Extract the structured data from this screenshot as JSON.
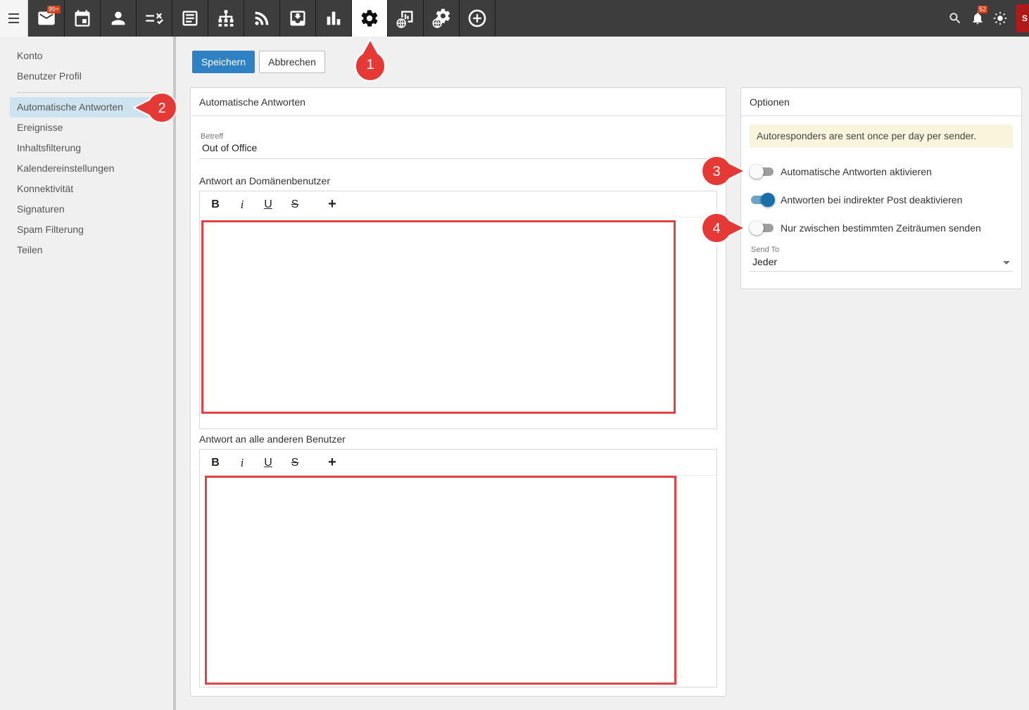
{
  "topbar": {
    "menu_icon": "hamburger-icon",
    "tabs": [
      {
        "icon": "mail-icon",
        "badge": "99+"
      },
      {
        "icon": "calendar-icon"
      },
      {
        "icon": "contacts-icon"
      },
      {
        "icon": "tasks-icon"
      },
      {
        "icon": "notes-icon"
      },
      {
        "icon": "sitemap-icon"
      },
      {
        "icon": "rss-icon"
      },
      {
        "icon": "inbox-download-icon"
      },
      {
        "icon": "bar-chart-icon"
      },
      {
        "icon": "gear-icon",
        "active": true
      },
      {
        "icon": "domain-report-icon"
      },
      {
        "icon": "domain-settings-icon"
      },
      {
        "icon": "add-circle-icon"
      }
    ],
    "notifications_badge": "52",
    "avatar_letter": "S"
  },
  "sidebar": {
    "items": [
      {
        "label": "Konto"
      },
      {
        "label": "Benutzer Profil"
      },
      {
        "label": "Automatische Antworten",
        "selected": true
      },
      {
        "label": "Ereignisse"
      },
      {
        "label": "Inhaltsfilterung"
      },
      {
        "label": "Kalendereinstellungen"
      },
      {
        "label": "Konnektivität"
      },
      {
        "label": "Signaturen"
      },
      {
        "label": "Spam Filterung"
      },
      {
        "label": "Teilen"
      }
    ]
  },
  "actions": {
    "save_label": "Speichern",
    "cancel_label": "Abbrechen"
  },
  "autoreply": {
    "panel_title": "Automatische Antworten",
    "subject_label": "Betreff",
    "subject_value": "Out of Office",
    "domain_users_label": "Antwort an Domänenbenutzer",
    "other_users_label": "Antwort an alle anderen Benutzer",
    "toolbar": {
      "bold": "B",
      "italic": "i",
      "underline": "U",
      "strike": "S",
      "more": "+"
    }
  },
  "options": {
    "panel_title": "Optionen",
    "notice": "Autoresponders are sent once per day per sender.",
    "toggles": [
      {
        "label": "Automatische Antworten aktivieren",
        "on": false
      },
      {
        "label": "Antworten bei indirekter Post deaktivieren",
        "on": true
      },
      {
        "label": "Nur zwischen bestimmten Zeiträumen senden",
        "on": false
      }
    ],
    "send_to_label": "Send To",
    "send_to_value": "Jeder"
  },
  "callouts": [
    "1",
    "2",
    "3",
    "4"
  ],
  "colors": {
    "topbar": "#3d3d3d",
    "primary": "#2e82c4",
    "callout": "#e53935",
    "highlight_box": "#e04545",
    "toggle_on": "#1a6ea8",
    "selected_item": "#cde3ef"
  }
}
